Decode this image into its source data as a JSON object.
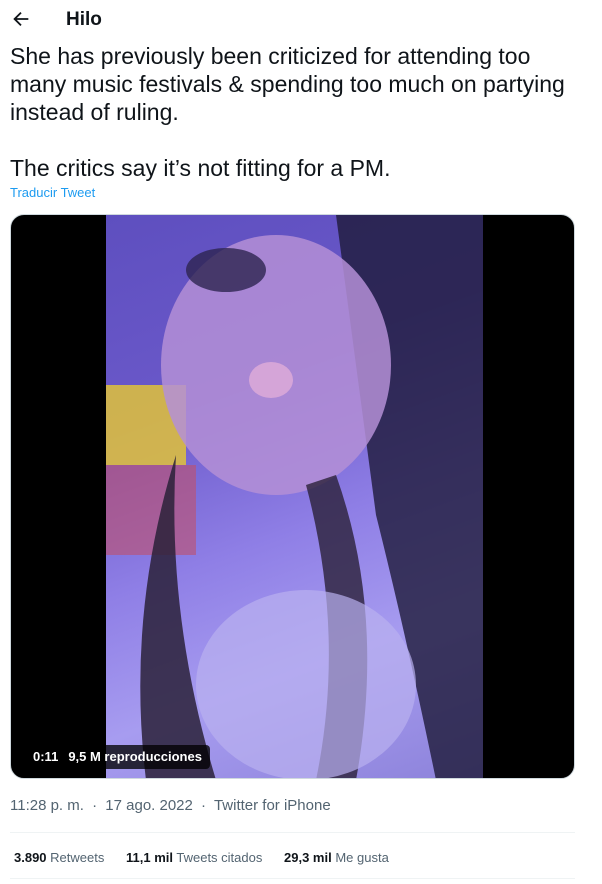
{
  "header": {
    "title": "Hilo",
    "back_icon": "arrow-left-icon"
  },
  "tweet": {
    "text": "She has previously been criticized for attending too many music festivals & spending too much on partying instead of ruling.\n\nThe critics say it’s not fitting for a PM.",
    "translate_label": "Traducir Tweet"
  },
  "video": {
    "duration": "0:11",
    "views": "9,5 M reproducciones"
  },
  "meta": {
    "time": "11:28 p. m.",
    "separator": "·",
    "date": "17 ago. 2022",
    "source": "Twitter for iPhone"
  },
  "stats": [
    {
      "value": "3.890",
      "label": "Retweets"
    },
    {
      "value": "11,1 mil",
      "label": "Tweets citados"
    },
    {
      "value": "29,3 mil",
      "label": "Me gusta"
    }
  ],
  "colors": {
    "link": "#1d9bf0",
    "text": "#0f1419",
    "muted": "#536471"
  }
}
